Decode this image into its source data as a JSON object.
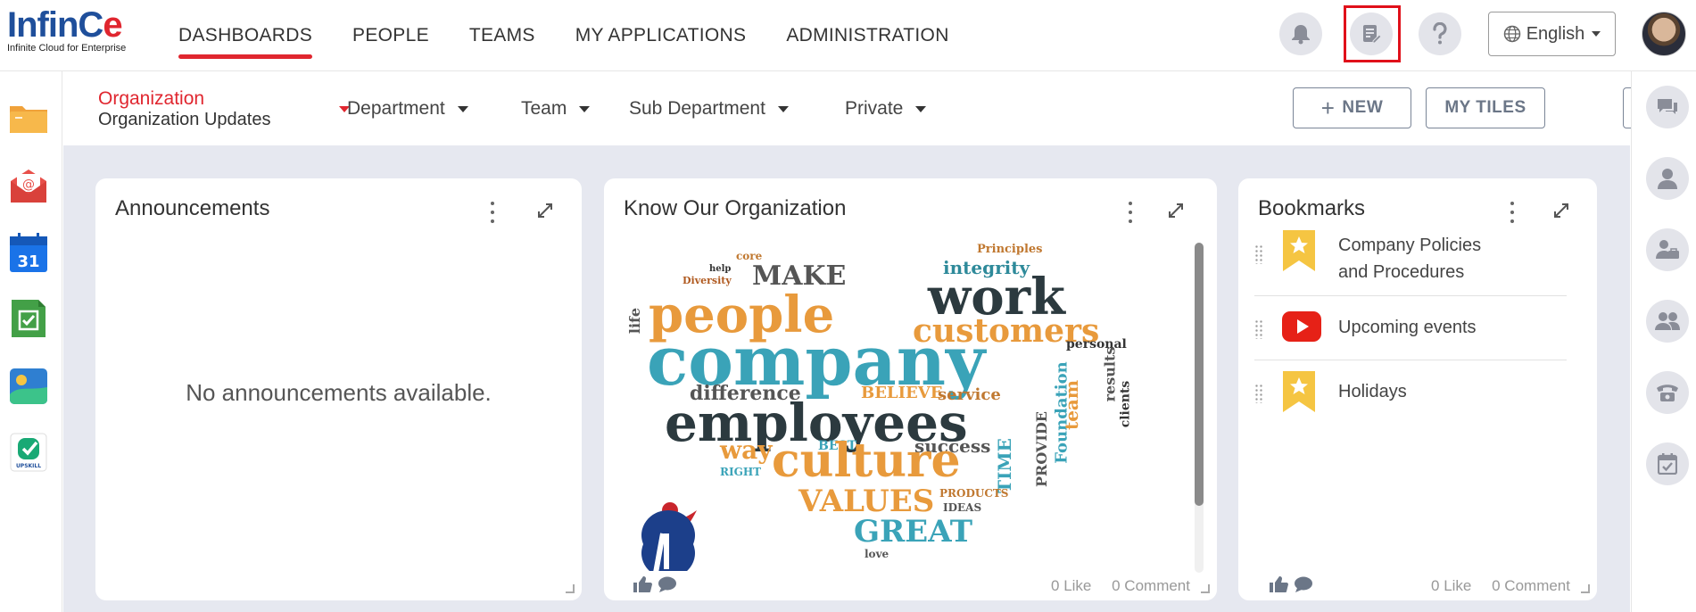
{
  "logo": {
    "main_a": "Inf",
    "main_b": "inC",
    "main_c": "e",
    "subtitle": "Infinite Cloud for Enterprise"
  },
  "topnav": {
    "items": [
      "DASHBOARDS",
      "PEOPLE",
      "TEAMS",
      "MY APPLICATIONS",
      "ADMINISTRATION"
    ],
    "active": "DASHBOARDS"
  },
  "header": {
    "language": "English",
    "accent_color": "#e0262f",
    "brand_color": "#1f4f9b"
  },
  "subnav": {
    "org_title": "Organization",
    "org_selected": "Organization Updates",
    "items": [
      "Department",
      "Team",
      "Sub Department",
      "Private"
    ],
    "new_label": "NEW",
    "my_tiles_label": "MY TILES"
  },
  "cards": {
    "announcements": {
      "title": "Announcements",
      "empty": "No announcements available."
    },
    "know": {
      "title": "Know Our Organization",
      "likes": "0 Like",
      "comments": "0 Comment",
      "words": [
        "core",
        "help",
        "Diversity",
        "MAKE",
        "Principles",
        "integrity",
        "work",
        "people",
        "customers",
        "life",
        "company",
        "personal",
        "difference",
        "BELIEVE",
        "service",
        "employees",
        "results",
        "Foundation",
        "team",
        "clients",
        "way",
        "BEST",
        "success",
        "culture",
        "TIME",
        "PROVIDE",
        "VALUES",
        "PRODUCTS",
        "IDEAS",
        "GREAT",
        "RIGHT",
        "love"
      ]
    },
    "bookmarks": {
      "title": "Bookmarks",
      "items": [
        {
          "line1": "Company Policies",
          "line2": "and Procedures",
          "icon": "star-bookmark-icon"
        },
        {
          "line1": "Upcoming events",
          "line2": "",
          "icon": "youtube-icon"
        },
        {
          "line1": "Holidays",
          "line2": "",
          "icon": "star-bookmark-icon"
        }
      ],
      "likes": "0 Like",
      "comments": "0 Comment"
    }
  },
  "left_apps": [
    "folder-icon",
    "mail-icon",
    "calendar-icon",
    "tasks-icon",
    "gallery-icon",
    "upskill-icon"
  ],
  "calendar_day": "31",
  "upskill_text": "UPSKILL",
  "right_tools": [
    "chat-icon",
    "user-icon",
    "user-tie-icon",
    "group-icon",
    "phone-icon",
    "calendar-check-icon"
  ]
}
